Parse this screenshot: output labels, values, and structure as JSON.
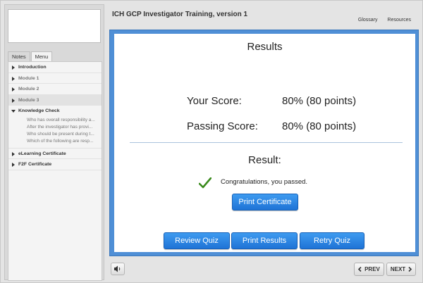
{
  "header": {
    "title": "ICH GCP Investigator Training, version 1",
    "links": [
      "Glossary",
      "Resources"
    ]
  },
  "sidebar": {
    "tabs": [
      {
        "label": "Notes",
        "active": false
      },
      {
        "label": "Menu",
        "active": true
      }
    ],
    "items": [
      {
        "label": "Introduction"
      },
      {
        "label": "Module 1"
      },
      {
        "label": "Module 2"
      },
      {
        "label": "Module 3"
      },
      {
        "label": "Knowledge Check"
      },
      {
        "label": "eLearning Certificate"
      },
      {
        "label": "F2F Certificate"
      }
    ],
    "knowledge_check_subitems": [
      "Who has overall responsibility a...",
      "After the investigator has provi...",
      "Who should be present during t...",
      "Which of the following are resp..."
    ]
  },
  "results": {
    "title": "Results",
    "your_score_label": "Your Score:",
    "your_score_value": "80% (80 points)",
    "passing_score_label": "Passing Score:",
    "passing_score_value": "80% (80 points)",
    "result_label": "Result:",
    "message": "Congratulations, you passed.",
    "print_certificate": "Print Certificate",
    "review_quiz": "Review Quiz",
    "print_results": "Print Results",
    "retry_quiz": "Retry Quiz"
  },
  "footer": {
    "prev_label": "PREV",
    "next_label": "NEXT"
  },
  "colors": {
    "accent": "#4f8fd6",
    "button": "#2a86e6",
    "check": "#3a8a1c"
  },
  "icons": [
    "check-icon",
    "sound-icon",
    "prev-arrow-icon",
    "next-arrow-icon",
    "collapse-arrow-icon",
    "expand-arrow-icon"
  ]
}
